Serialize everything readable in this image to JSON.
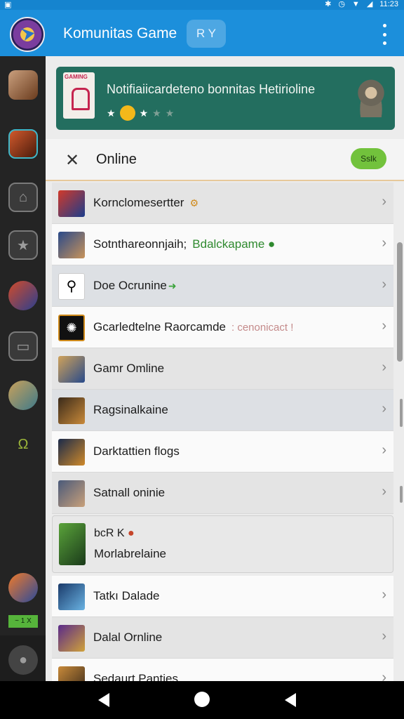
{
  "status_bar": {
    "time": "11:23",
    "icons": [
      "bluetooth-icon",
      "alarm-icon",
      "wifi-icon",
      "signal-icon"
    ]
  },
  "app_bar": {
    "title": "Komunitas Game",
    "chip_label": "R Y"
  },
  "banner": {
    "thumb_label": "GAMING",
    "text": "Notifiaiicardeteno bonnitas Hetirioline",
    "stars_filled": 2,
    "stars_total": 4
  },
  "section": {
    "title": "Online",
    "pill_label": "Sslk"
  },
  "rows": [
    {
      "label": "Kornclomesertter",
      "extra": "⚙"
    },
    {
      "label": "Sotnthareonnjaih;",
      "extra": "Bdalckapame ●"
    },
    {
      "label": "Doe Ocrunine",
      "extra": "➜"
    },
    {
      "label": "Gcarledtelne Raorcamde",
      "extra": ": cenonicact !"
    },
    {
      "label": "Gamr Omline",
      "extra": ""
    },
    {
      "label": "Ragsinalkaine",
      "extra": ""
    },
    {
      "label": "Darktattien flogs",
      "extra": ""
    },
    {
      "label": "Satnall oninie",
      "extra": ""
    }
  ],
  "card": {
    "line1": "bcR  K",
    "line2": "Morlabrelaine"
  },
  "rows_after": [
    {
      "label": "Tatkı Dalade"
    },
    {
      "label": "Dalal Ornline"
    },
    {
      "label": "Sedaurt Panties"
    }
  ],
  "rail": {
    "badge": "~ 1 X"
  },
  "colors": {
    "app_bar": "#1c8fdb",
    "banner": "#236e5f",
    "pill": "#72c23c",
    "rail": "#242424"
  }
}
